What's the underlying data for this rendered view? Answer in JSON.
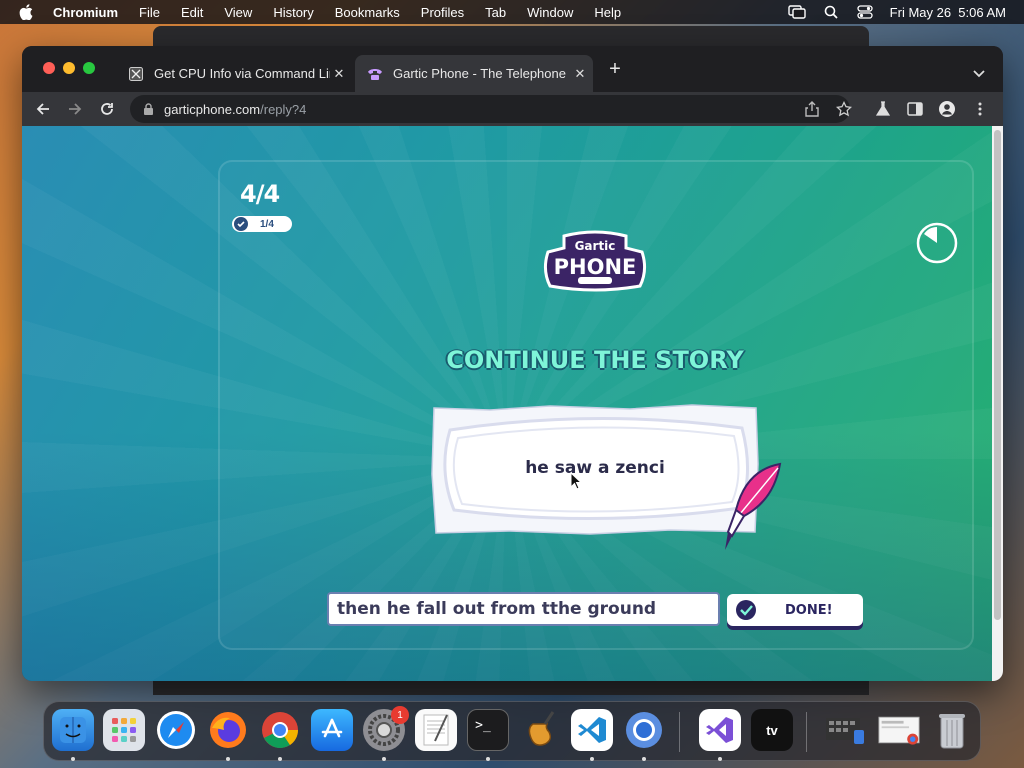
{
  "menubar": {
    "app": "Chromium",
    "items": [
      "File",
      "Edit",
      "View",
      "History",
      "Bookmarks",
      "Profiles",
      "Tab",
      "Window",
      "Help"
    ],
    "datetime": "Fri May 26  5:06 AM"
  },
  "browser": {
    "tabs": [
      {
        "title": "Get CPU Info via Command Lin",
        "favicon": "tab-favicon-icon"
      },
      {
        "title": "Gartic Phone - The Telephone G",
        "favicon": "phone-icon"
      }
    ],
    "url": {
      "domain": "garticphone.com",
      "path": "/reply?4"
    }
  },
  "game": {
    "round": "4/4",
    "done_count": "1/4",
    "logo_top": "Gartic",
    "logo_main": "PHONE",
    "heading": "CONTINUE THE STORY",
    "prompt_text": "he saw a zenci",
    "answer_value": "then he fall out from tthe ground",
    "done_label": "DONE!",
    "colors": {
      "heading": "#7ef5d8",
      "button_text": "#2a2560",
      "logo": "#3b2466"
    }
  },
  "dock": {
    "items": [
      "finder",
      "launchpad",
      "safari",
      "firefox",
      "chrome",
      "app-store",
      "system-preferences",
      "textedit",
      "terminal",
      "garageband",
      "vscode",
      "chromium",
      "visual-studio",
      "apple-tv",
      "downloads-stack",
      "documents-stack",
      "trash"
    ],
    "system_preferences_badge": "1"
  }
}
